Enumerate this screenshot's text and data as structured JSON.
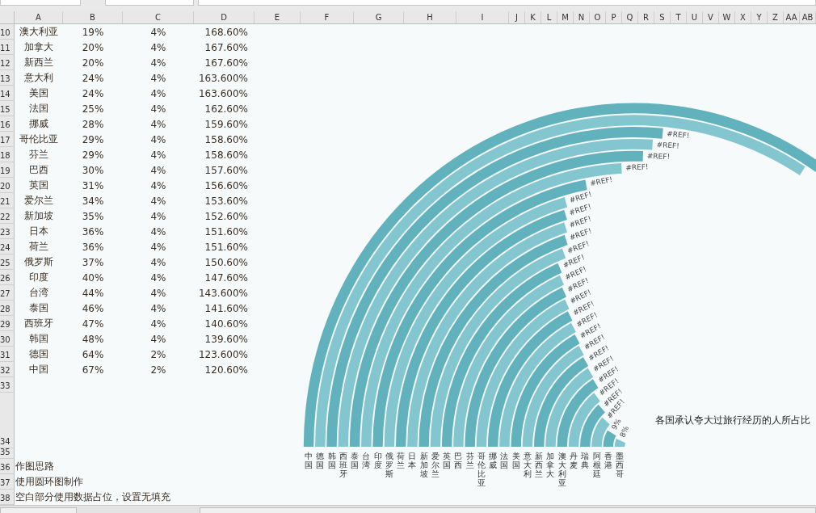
{
  "columns": [
    "A",
    "B",
    "C",
    "D",
    "E",
    "F",
    "G",
    "H",
    "I",
    "J",
    "K",
    "L",
    "M",
    "N",
    "O",
    "P",
    "Q",
    "R",
    "S",
    "T",
    "U",
    "V",
    "W",
    "X",
    "Y",
    "Z",
    "AA",
    "AB"
  ],
  "rows": [
    {
      "number": "10",
      "kind": "data",
      "cells": [
        "澳大利亚",
        "19%",
        "4%",
        "168.60%"
      ]
    },
    {
      "number": "11",
      "kind": "data",
      "cells": [
        "加拿大",
        "20%",
        "4%",
        "167.60%"
      ]
    },
    {
      "number": "12",
      "kind": "data",
      "cells": [
        "新西兰",
        "20%",
        "4%",
        "167.60%"
      ]
    },
    {
      "number": "13",
      "kind": "data",
      "cells": [
        "意大利",
        "24%",
        "4%",
        "163.600%"
      ]
    },
    {
      "number": "14",
      "kind": "data",
      "cells": [
        "美国",
        "24%",
        "4%",
        "163.600%"
      ]
    },
    {
      "number": "15",
      "kind": "data",
      "cells": [
        "法国",
        "25%",
        "4%",
        "162.60%"
      ]
    },
    {
      "number": "16",
      "kind": "data",
      "cells": [
        "挪威",
        "28%",
        "4%",
        "159.60%"
      ]
    },
    {
      "number": "17",
      "kind": "data",
      "cells": [
        "哥伦比亚",
        "29%",
        "4%",
        "158.60%"
      ]
    },
    {
      "number": "18",
      "kind": "data",
      "cells": [
        "芬兰",
        "29%",
        "4%",
        "158.60%"
      ]
    },
    {
      "number": "19",
      "kind": "data",
      "cells": [
        "巴西",
        "30%",
        "4%",
        "157.60%"
      ]
    },
    {
      "number": "20",
      "kind": "data",
      "cells": [
        "英国",
        "31%",
        "4%",
        "156.60%"
      ]
    },
    {
      "number": "21",
      "kind": "data",
      "cells": [
        "爱尔兰",
        "34%",
        "4%",
        "153.60%"
      ]
    },
    {
      "number": "22",
      "kind": "data",
      "cells": [
        "新加坡",
        "35%",
        "4%",
        "152.60%"
      ]
    },
    {
      "number": "23",
      "kind": "data",
      "cells": [
        "日本",
        "36%",
        "4%",
        "151.60%"
      ]
    },
    {
      "number": "24",
      "kind": "data",
      "cells": [
        "荷兰",
        "36%",
        "4%",
        "151.60%"
      ]
    },
    {
      "number": "25",
      "kind": "data",
      "cells": [
        "俄罗斯",
        "37%",
        "4%",
        "150.60%"
      ]
    },
    {
      "number": "26",
      "kind": "data",
      "cells": [
        "印度",
        "40%",
        "4%",
        "147.60%"
      ]
    },
    {
      "number": "27",
      "kind": "data",
      "cells": [
        "台湾",
        "44%",
        "4%",
        "143.600%"
      ]
    },
    {
      "number": "28",
      "kind": "data",
      "cells": [
        "泰国",
        "46%",
        "4%",
        "141.60%"
      ]
    },
    {
      "number": "29",
      "kind": "data",
      "cells": [
        "西班牙",
        "47%",
        "4%",
        "140.60%"
      ]
    },
    {
      "number": "30",
      "kind": "data",
      "cells": [
        "韩国",
        "48%",
        "4%",
        "139.60%"
      ]
    },
    {
      "number": "31",
      "kind": "data",
      "cells": [
        "德国",
        "64%",
        "2%",
        "123.600%"
      ]
    },
    {
      "number": "32",
      "kind": "data",
      "cells": [
        "中国",
        "67%",
        "2%",
        "120.60%"
      ]
    },
    {
      "number": "33",
      "kind": "empty"
    },
    {
      "number": "34",
      "kind": "empty"
    },
    {
      "number": "35",
      "kind": "empty"
    },
    {
      "number": "36",
      "kind": "note",
      "text": "作图思路"
    },
    {
      "number": "37",
      "kind": "note",
      "text": "使用圆环图制作"
    },
    {
      "number": "38",
      "kind": "note",
      "text": "空白部分使用数据占位，设置无填充"
    }
  ],
  "chart": {
    "title": "各国承认夸大过旅行经历的人所占比",
    "rings": [
      {
        "label": "中国"
      },
      {
        "label": "德国"
      },
      {
        "label": "韩国",
        "data_label": "#REF!"
      },
      {
        "label": "西班牙",
        "data_label": "#REF!"
      },
      {
        "label": "泰国",
        "data_label": "#REF!"
      },
      {
        "label": "台湾",
        "data_label": "#REF!"
      },
      {
        "label": "印度",
        "data_label": "#REF!"
      },
      {
        "label": "俄罗斯",
        "data_label": "#REF!"
      },
      {
        "label": "荷兰",
        "data_label": "#REF!"
      },
      {
        "label": "日本",
        "data_label": "#REF!"
      },
      {
        "label": "新加坡",
        "data_label": "#REF!"
      },
      {
        "label": "爱尔兰",
        "data_label": "#REF!"
      },
      {
        "label": "英国",
        "data_label": "#REF!"
      },
      {
        "label": "巴西",
        "data_label": "#REF!"
      },
      {
        "label": "芬兰",
        "data_label": "#REF!"
      },
      {
        "label": "哥伦比亚",
        "data_label": "#REF!"
      },
      {
        "label": "挪威",
        "data_label": "#REF!"
      },
      {
        "label": "法国",
        "data_label": "#REF!"
      },
      {
        "label": "美国",
        "data_label": "#REF!"
      },
      {
        "label": "意大利",
        "data_label": "#REF!"
      },
      {
        "label": "新西兰",
        "data_label": "#REF!"
      },
      {
        "label": "加拿大",
        "data_label": "#REF!"
      },
      {
        "label": "澳大利亚",
        "data_label": "#REF!"
      },
      {
        "label": "丹麦",
        "data_label": "#REF!"
      },
      {
        "label": "瑞典",
        "data_label": "#REF!"
      },
      {
        "label": "阿根廷",
        "data_label": "#REF!"
      },
      {
        "label": "香港",
        "data_label": "9%"
      },
      {
        "label": "墨西哥",
        "data_label": "8%"
      }
    ]
  }
}
